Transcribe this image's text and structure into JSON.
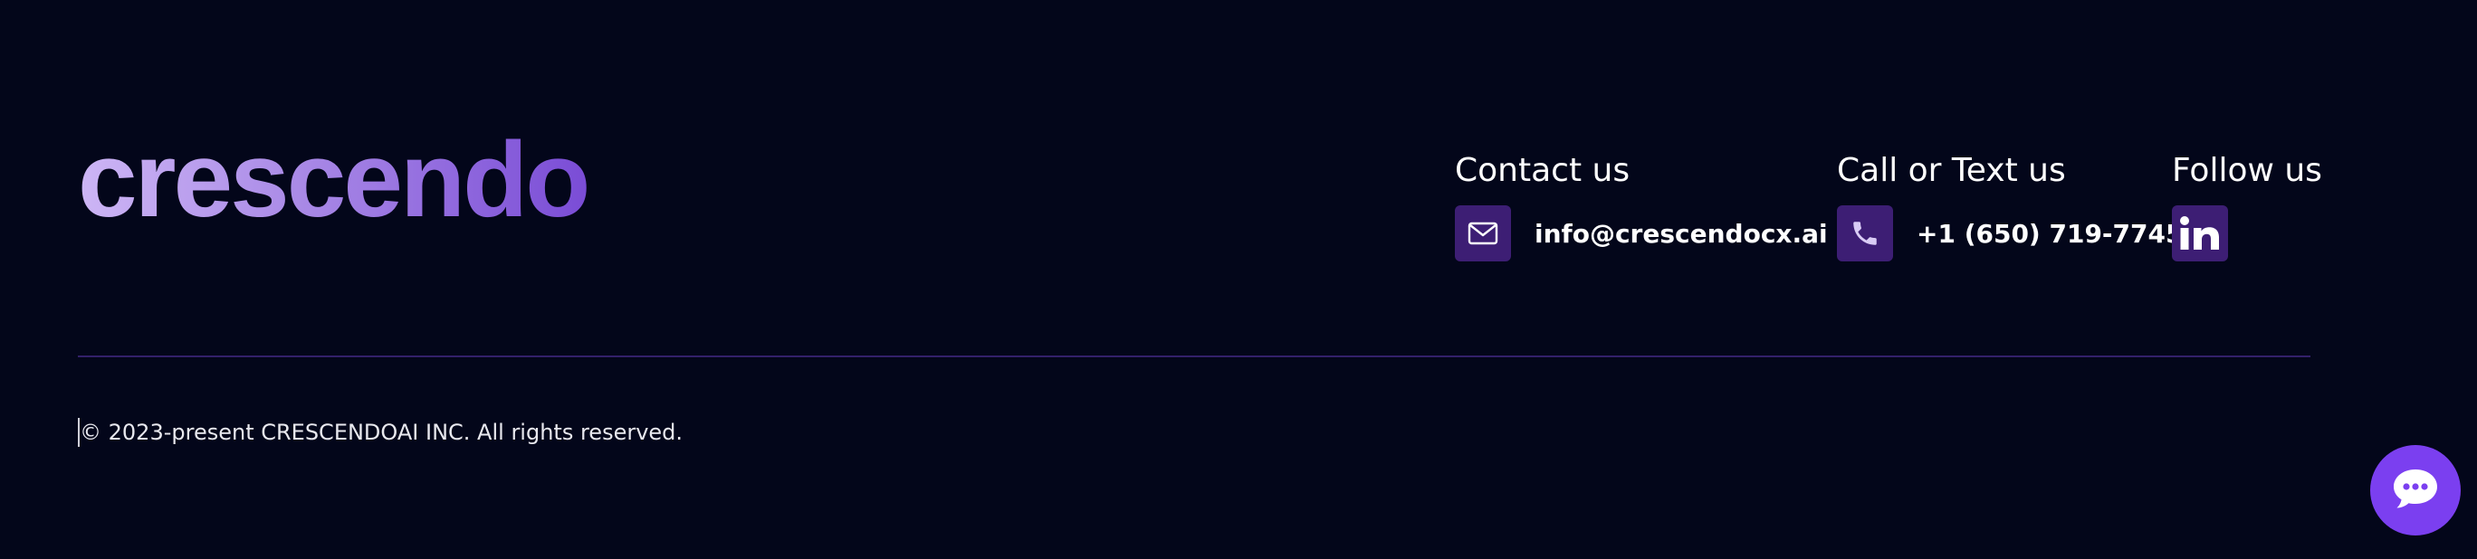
{
  "brand": {
    "logo_text": "crescendo"
  },
  "contact": {
    "title": "Contact us",
    "email": "info@crescendocx.ai",
    "icon": "mail-icon"
  },
  "call": {
    "title": "Call or Text us",
    "phone": "+1 (650) 719-7745",
    "icon": "phone-icon"
  },
  "follow": {
    "title": "Follow us",
    "icon": "linkedin-icon"
  },
  "legal": {
    "copyright": "© 2023-present CRESCENDOAI INC. All rights reserved."
  },
  "chat": {
    "icon": "chat-bubble-icon"
  },
  "colors": {
    "background": "#03061a",
    "icon_tile": "#3d1e74",
    "divider": "#33206a",
    "chat_button": "#7b3ff0",
    "logo_gradient_start": "#cdb6f5",
    "logo_gradient_end": "#7a4cd6"
  }
}
